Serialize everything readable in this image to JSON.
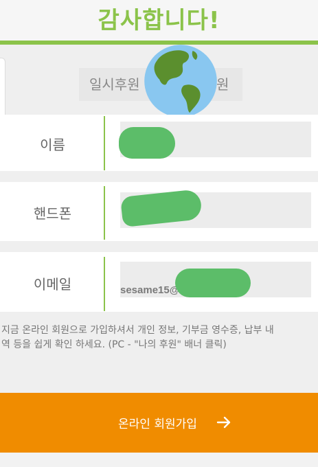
{
  "header": {
    "title": "감사합니다!"
  },
  "tabs": [
    {
      "label": "일시후원"
    },
    {
      "label": "원"
    }
  ],
  "form": {
    "name_label": "이름",
    "phone_label": "핸드폰",
    "email_label": "이메일",
    "email_value": "sesame15@"
  },
  "info_lines": [
    "지금 온라인 회원으로 가입하셔서 개인 정보, 기부금 영수증, 납부 내",
    "역 등을 쉽게 확인 하세요. (PC - \"나의 후원\" 배너 클릭)"
  ],
  "signup_button": {
    "label": "온라인 회원가입"
  },
  "colors": {
    "accent_green": "#8bc34a",
    "signup_orange": "#f08c00",
    "redaction_green": "#5cbd69"
  },
  "icons": {
    "globe": "globe-emoji-icon",
    "arrow": "arrow-right-icon"
  }
}
